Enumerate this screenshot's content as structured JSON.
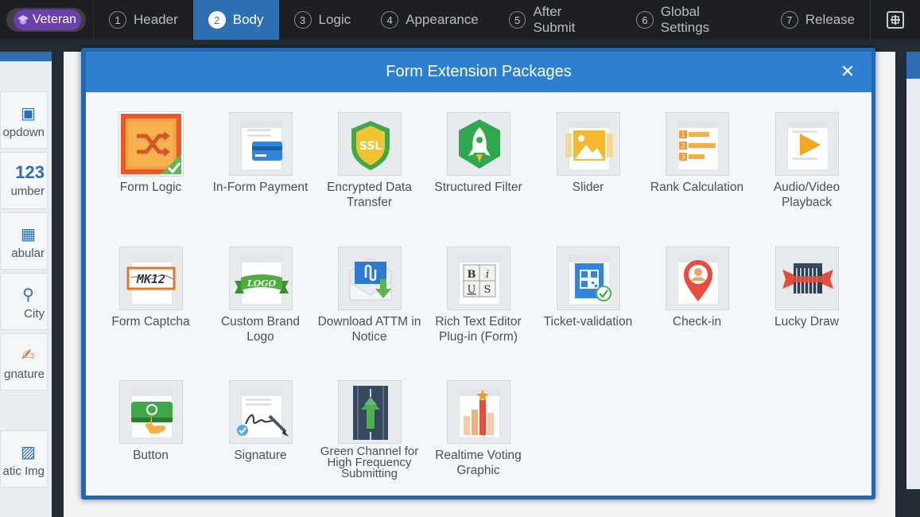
{
  "topnav": {
    "badge": "Veteran",
    "steps": [
      {
        "num": "1",
        "label": "Header"
      },
      {
        "num": "2",
        "label": "Body"
      },
      {
        "num": "3",
        "label": "Logic"
      },
      {
        "num": "4",
        "label": "Appearance"
      },
      {
        "num": "5",
        "label": "After Submit"
      },
      {
        "num": "6",
        "label": "Global Settings"
      },
      {
        "num": "7",
        "label": "Release"
      }
    ],
    "active_step": "Body"
  },
  "left_panel": {
    "items": [
      {
        "label": "opdown"
      },
      {
        "icon_text": "123",
        "label": "umber"
      },
      {
        "label": "abular"
      },
      {
        "label": "City"
      },
      {
        "label": "gnature"
      },
      {
        "label": "atic Img"
      }
    ]
  },
  "modal": {
    "title": "Form Extension Packages",
    "close_symbol": "✕",
    "packages": [
      {
        "label": "Form Logic",
        "icon": "shuffle-icon",
        "installed": true
      },
      {
        "label": "In-Form Payment",
        "icon": "credit-card-icon"
      },
      {
        "label": "Encrypted Data Transfer",
        "icon": "ssl-shield-icon"
      },
      {
        "label": "Structured Filter",
        "icon": "rocket-icon"
      },
      {
        "label": "Slider",
        "icon": "image-slider-icon"
      },
      {
        "label": "Rank Calculation",
        "icon": "rank-list-icon"
      },
      {
        "label": "Audio/Video Playback",
        "icon": "play-icon"
      },
      {
        "label": "Form Captcha",
        "icon": "captcha-icon",
        "icon_text": "MK12"
      },
      {
        "label": "Custom Brand Logo",
        "icon": "logo-ribbon-icon",
        "icon_text": "LOGO"
      },
      {
        "label": "Download ATTM in Notice",
        "icon": "attachment-download-icon"
      },
      {
        "label": "Rich Text Editor Plug-in (Form)",
        "icon": "rich-text-icon",
        "icon_text": [
          "B",
          "i",
          "U",
          "S"
        ]
      },
      {
        "label": "Ticket-validation",
        "icon": "qr-ticket-icon"
      },
      {
        "label": "Check-in",
        "icon": "location-pin-icon"
      },
      {
        "label": "Lucky Draw",
        "icon": "lucky-draw-icon"
      },
      {
        "label": "Button",
        "icon": "button-press-icon"
      },
      {
        "label": "Signature",
        "icon": "signature-pen-icon"
      },
      {
        "label": "Green Channel for High Frequency Submitting",
        "icon": "green-channel-icon"
      },
      {
        "label": "Realtime Voting Graphic",
        "icon": "voting-chart-icon"
      }
    ]
  },
  "colors": {
    "nav_bg": "#1d1f22",
    "active_step": "#2e6fb3",
    "modal_header": "#2f7fcf",
    "modal_frame": "#2466b0",
    "badge": "#6c3fb0"
  }
}
